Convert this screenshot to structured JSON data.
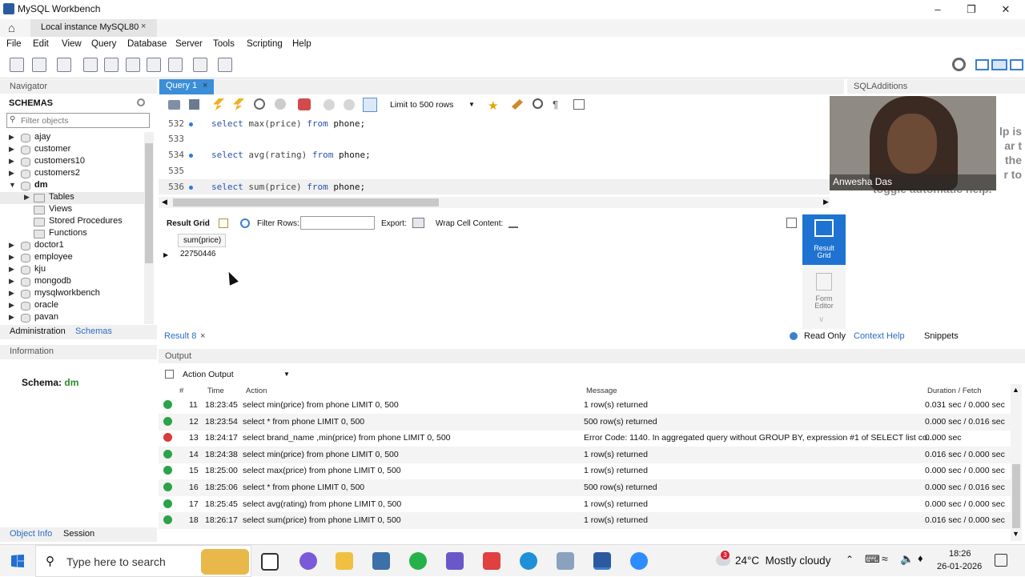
{
  "window": {
    "title": "MySQL Workbench"
  },
  "connection_tab": {
    "label": "Local instance MySQL80",
    "close": "×"
  },
  "menu": [
    "File",
    "Edit",
    "View",
    "Query",
    "Database",
    "Server",
    "Tools",
    "Scripting",
    "Help"
  ],
  "navigator": {
    "header": "Navigator",
    "schemas_label": "SCHEMAS",
    "filter_placeholder": "Filter objects",
    "items": [
      "ajay",
      "customer",
      "customers10",
      "customers2",
      "dm"
    ],
    "dm_children": [
      "Tables",
      "Views",
      "Stored Procedures",
      "Functions"
    ],
    "items_after": [
      "doctor1",
      "employee",
      "kju",
      "mongodb",
      "mysqlworkbench",
      "oracle",
      "pavan"
    ],
    "tabs": [
      "Administration",
      "Schemas"
    ]
  },
  "information": {
    "header": "Information",
    "schema_label": "Schema:",
    "schema_value": "dm",
    "tabs": [
      "Object Info",
      "Session"
    ]
  },
  "query_tab": {
    "label": "Query 1",
    "close": "×"
  },
  "query_toolbar": {
    "limit_select": "Limit to 500 rows"
  },
  "editor": {
    "lines": [
      {
        "num": "532",
        "code_kw1": "select ",
        "code_fn": "max(price)",
        "code_kw2": " from ",
        "code_rest": "phone;"
      },
      {
        "num": "533"
      },
      {
        "num": "534",
        "code_kw1": "select ",
        "code_fn": "avg(rating)",
        "code_kw2": " from ",
        "code_rest": "phone;"
      },
      {
        "num": "535"
      },
      {
        "num": "536",
        "code_kw1": "select ",
        "code_fn": "sum(price)",
        "code_kw2": " from ",
        "code_rest": "phone;"
      }
    ]
  },
  "result_toolbar": {
    "result_grid": "Result Grid",
    "filter_rows": "Filter Rows:",
    "export": "Export:",
    "wrap": "Wrap Cell Content:"
  },
  "result_grid": {
    "column": "sum(price)",
    "value": "22750446"
  },
  "right_buttons": {
    "result_grid_line1": "Result",
    "result_grid_line2": "Grid",
    "form_editor_line1": "Form",
    "form_editor_line2": "Editor"
  },
  "result_tab": {
    "label": "Result 8",
    "close": "×",
    "read_only": "Read Only"
  },
  "sql_additions": {
    "header": "SQLAdditions",
    "help_text_1": "lp is",
    "help_text_2": "ar t",
    "help_text_3": "the",
    "help_text_4": "r to",
    "help_text_5": "toggle automatic help.",
    "tabs": [
      "Context Help",
      "Snippets"
    ],
    "webcam_name": "Anwesha Das"
  },
  "output": {
    "header": "Output",
    "mode": "Action Output",
    "columns": {
      "num": "#",
      "time": "Time",
      "action": "Action",
      "message": "Message",
      "duration": "Duration / Fetch"
    },
    "rows": [
      {
        "status": "ok",
        "num": "11",
        "time": "18:23:45",
        "action": "select min(price) from phone LIMIT 0, 500",
        "message": "1 row(s) returned",
        "duration": "0.031 sec / 0.000 sec"
      },
      {
        "status": "ok",
        "num": "12",
        "time": "18:23:54",
        "action": "select * from phone LIMIT 0, 500",
        "message": "500 row(s) returned",
        "duration": "0.000 sec / 0.016 sec"
      },
      {
        "status": "error",
        "num": "13",
        "time": "18:24:17",
        "action": "select brand_name ,min(price) from phone LIMIT 0, 500",
        "message": "Error Code: 1140. In aggregated query without GROUP BY, expression #1 of SELECT list co...",
        "duration": "0.000 sec"
      },
      {
        "status": "ok",
        "num": "14",
        "time": "18:24:38",
        "action": "select min(price) from phone LIMIT 0, 500",
        "message": "1 row(s) returned",
        "duration": "0.016 sec / 0.000 sec"
      },
      {
        "status": "ok",
        "num": "15",
        "time": "18:25:00",
        "action": "select max(price) from phone LIMIT 0, 500",
        "message": "1 row(s) returned",
        "duration": "0.000 sec / 0.000 sec"
      },
      {
        "status": "ok",
        "num": "16",
        "time": "18:25:06",
        "action": "select * from phone LIMIT 0, 500",
        "message": "500 row(s) returned",
        "duration": "0.000 sec / 0.016 sec"
      },
      {
        "status": "ok",
        "num": "17",
        "time": "18:25:45",
        "action": "select avg(rating) from phone LIMIT 0, 500",
        "message": "1 row(s) returned",
        "duration": "0.000 sec / 0.000 sec"
      },
      {
        "status": "ok",
        "num": "18",
        "time": "18:26:17",
        "action": "select sum(price) from phone LIMIT 0, 500",
        "message": "1 row(s) returned",
        "duration": "0.016 sec / 0.000 sec"
      }
    ]
  },
  "taskbar": {
    "search_placeholder": "Type here to search",
    "weather": "24°C  Mostly cloudy",
    "weather_badge": "3",
    "time": "18:26",
    "date": "26-01-2026"
  }
}
